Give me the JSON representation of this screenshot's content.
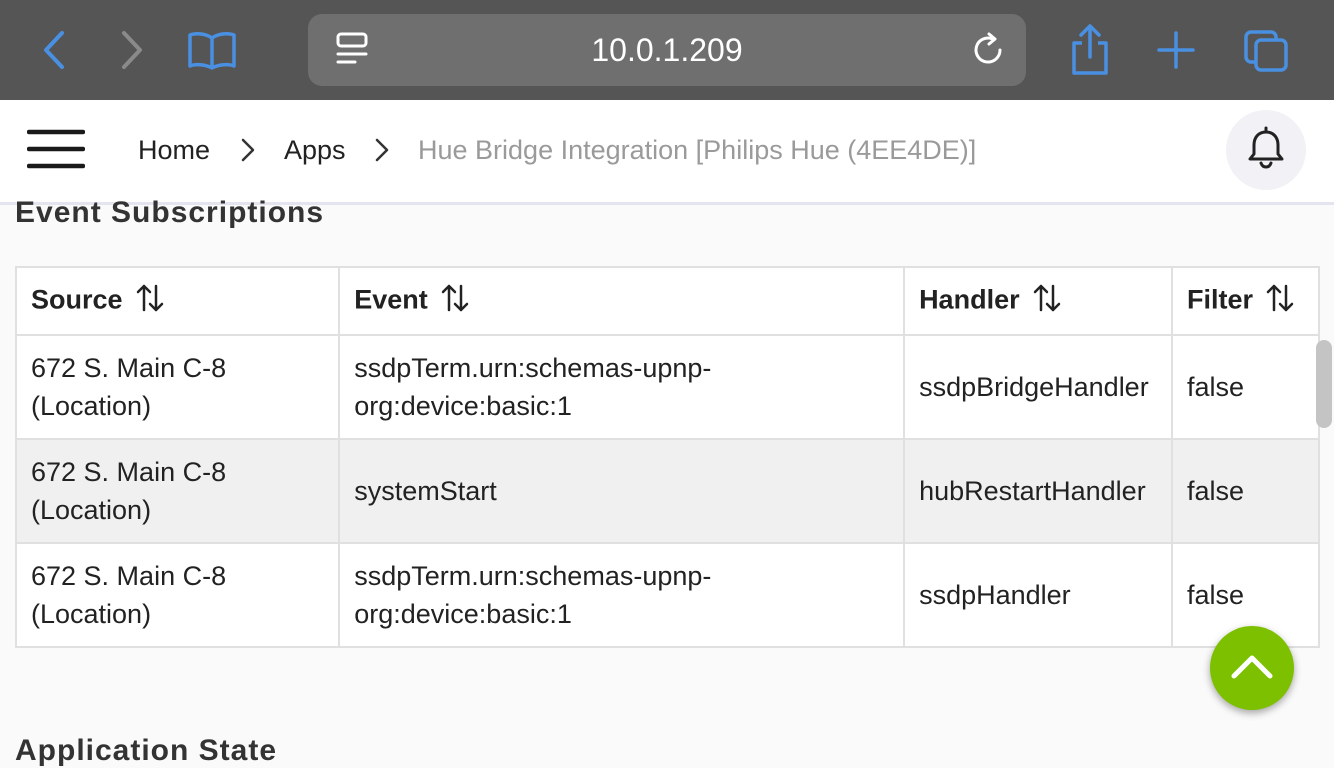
{
  "browser": {
    "url": "10.0.1.209"
  },
  "breadcrumb": {
    "home": "Home",
    "apps": "Apps",
    "current": "Hue Bridge Integration [Philips Hue (4EE4DE)]"
  },
  "section": {
    "title": "Event Subscriptions",
    "next_title": "Application State"
  },
  "table": {
    "headers": [
      "Source",
      "Event",
      "Handler",
      "Filter"
    ],
    "rows": [
      {
        "source": "672 S. Main C-8 (Location)",
        "event": "ssdpTerm.urn:schemas-upnp-org:device:basic:1",
        "handler": "ssdpBridgeHandler",
        "filter": "false"
      },
      {
        "source": "672 S. Main C-8 (Location)",
        "event": "systemStart",
        "handler": "hubRestartHandler",
        "filter": "false"
      },
      {
        "source": "672 S. Main C-8 (Location)",
        "event": "ssdpTerm.urn:schemas-upnp-org:device:basic:1",
        "handler": "ssdpHandler",
        "filter": "false"
      }
    ]
  },
  "icons": {
    "back": "chevron-left-icon",
    "forward": "chevron-right-icon",
    "bookmarks": "book-icon",
    "reader": "reader-mode-icon",
    "reload": "reload-icon",
    "share": "share-icon",
    "new_tab": "plus-icon",
    "tabs": "tabs-icon",
    "menu": "hamburger-menu-icon",
    "notifications": "bell-icon",
    "sort": "sort-icon",
    "scroll_top": "chevron-up-icon"
  },
  "colors": {
    "browser_accent": "#4a90e2",
    "fab": "#7cc000",
    "breadcrumb_current": "#9a9a9a"
  }
}
